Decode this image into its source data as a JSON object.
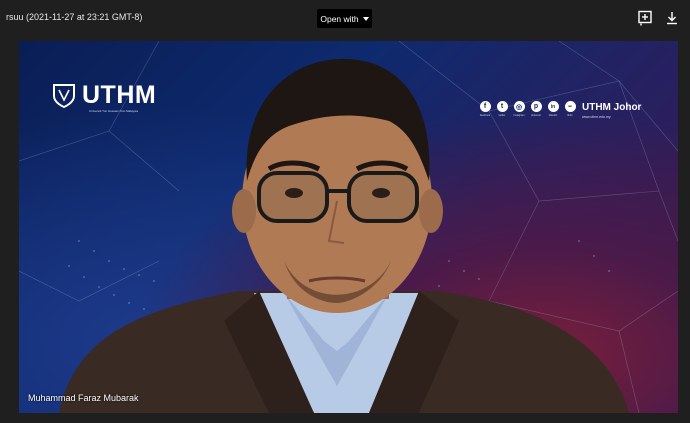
{
  "topbar": {
    "title": "rsuu (2021-11-27 at 23:21 GMT-8)",
    "open_with_label": "Open with",
    "icons": [
      "add-to-drive-icon",
      "download-icon"
    ]
  },
  "video": {
    "logo_text": "UTHM",
    "logo_subtext": "Universiti Tun Hussein Onn Malaysia",
    "brand_text": "UTHM Johor",
    "brand_subtext": "www.uthm.edu.my",
    "social_handles": [
      {
        "icon": "facebook-icon",
        "glyph": "f",
        "caption": "facebook"
      },
      {
        "icon": "twitter-icon",
        "glyph": "t",
        "caption": "twitter"
      },
      {
        "icon": "instagram-icon",
        "glyph": "◎",
        "caption": "instagram"
      },
      {
        "icon": "pinterest-icon",
        "glyph": "p",
        "caption": "pinterest"
      },
      {
        "icon": "linkedin-icon",
        "glyph": "in",
        "caption": "linkedin"
      },
      {
        "icon": "flickr-icon",
        "glyph": "••",
        "caption": "flickr"
      }
    ],
    "speaker_name": "Muhammad Faraz Mubarak"
  },
  "colors": {
    "background": "#1f1f1f",
    "button": "#000000",
    "video_blue": "#0e2a6e",
    "video_magenta": "#7a1f3a"
  }
}
